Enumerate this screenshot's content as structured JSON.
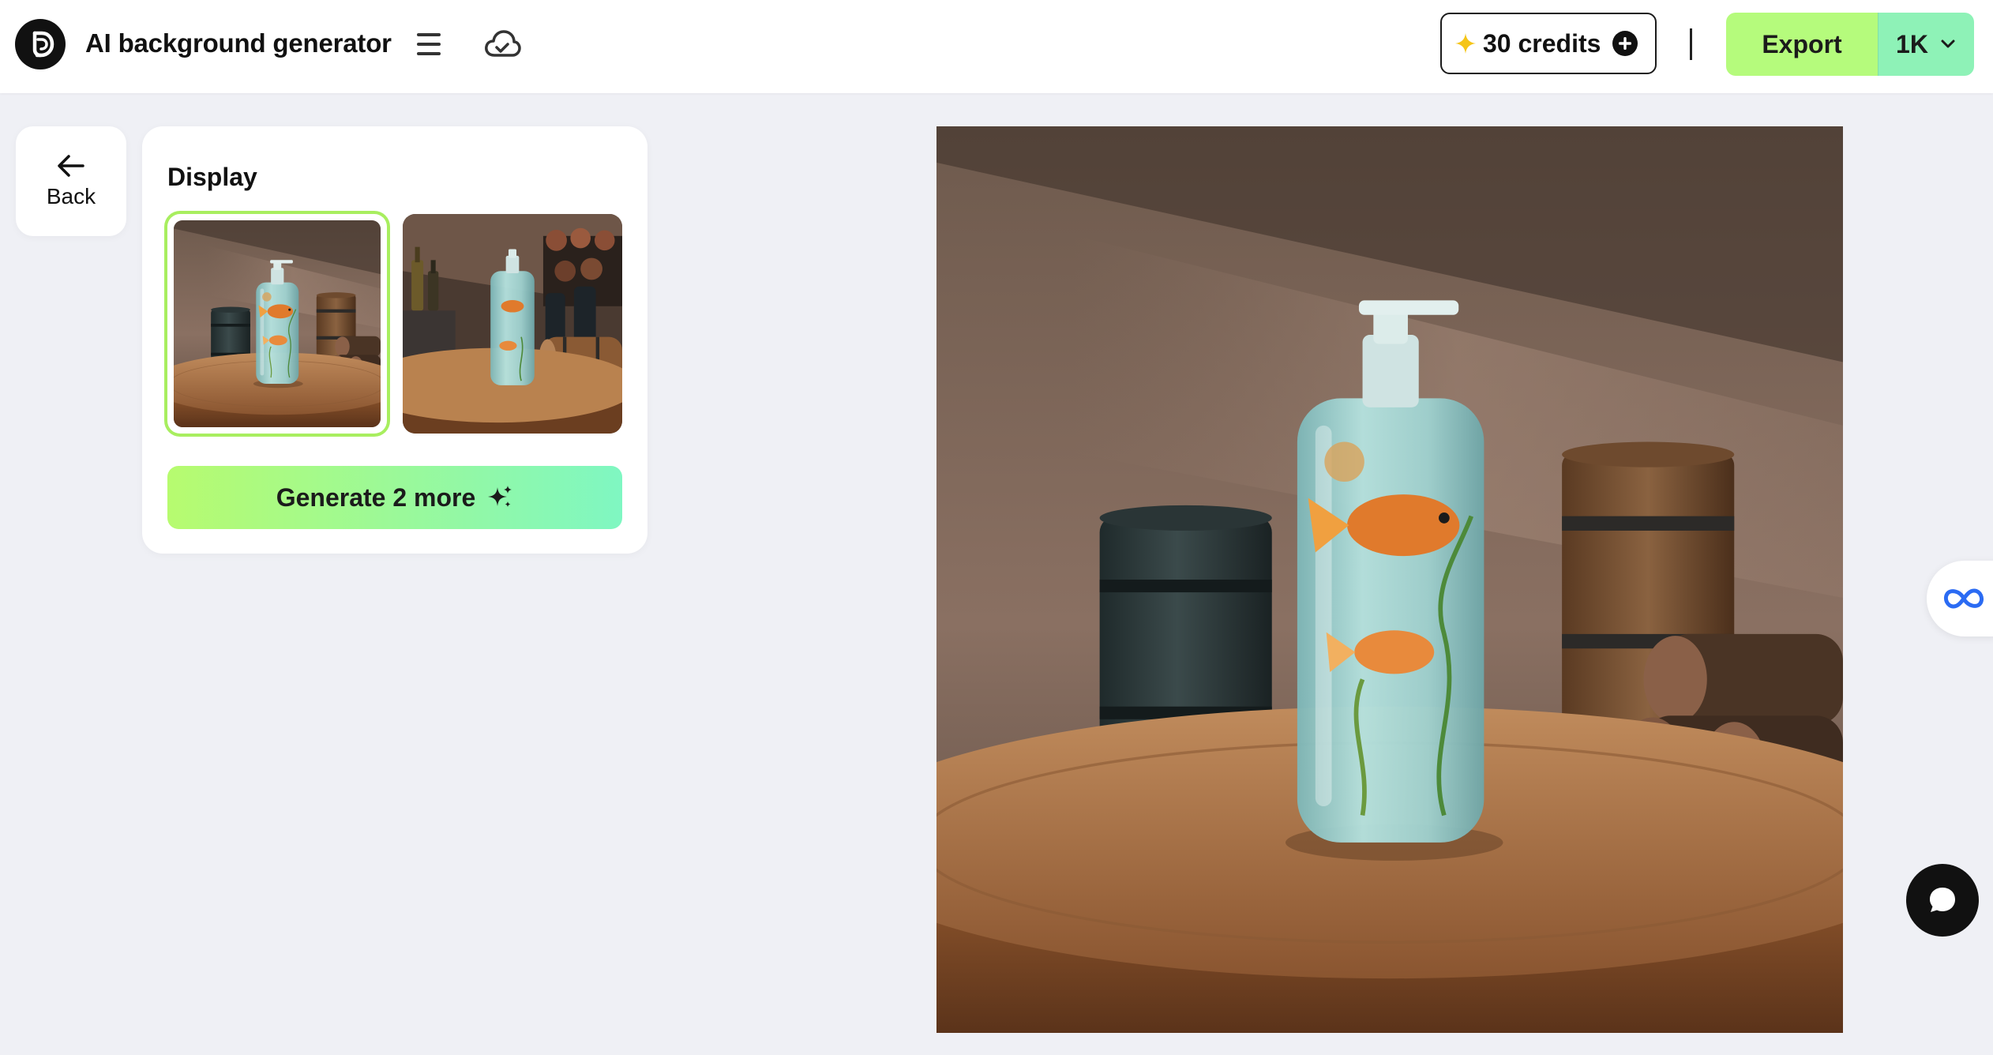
{
  "header": {
    "app_title": "AI background generator",
    "logo_icon": "brand-logo-icon",
    "menu_icon": "hamburger-menu-icon",
    "cloud_icon": "cloud-sync-icon",
    "credits_label": "30 credits",
    "credits_icon": "sparkle-icon",
    "add_credits_icon": "plus-circle-icon",
    "export_label": "Export",
    "resolution_label": "1K",
    "resolution_icon": "chevron-down-icon"
  },
  "back": {
    "label": "Back",
    "icon": "arrow-left-icon"
  },
  "display_panel": {
    "title": "Display",
    "thumbnails": [
      {
        "selected": true
      },
      {
        "selected": false
      }
    ],
    "generate_label": "Generate 2 more",
    "generate_icon": "sparkles-icon"
  },
  "floating": {
    "side_tab_icon": "infinity-icon",
    "chat_icon": "chat-bubble-icon"
  },
  "colors": {
    "background": "#eff0f5",
    "accent_green": "#b5fb7c",
    "accent_mint": "#8ef2b7",
    "selected_border": "#a8ee5f"
  }
}
